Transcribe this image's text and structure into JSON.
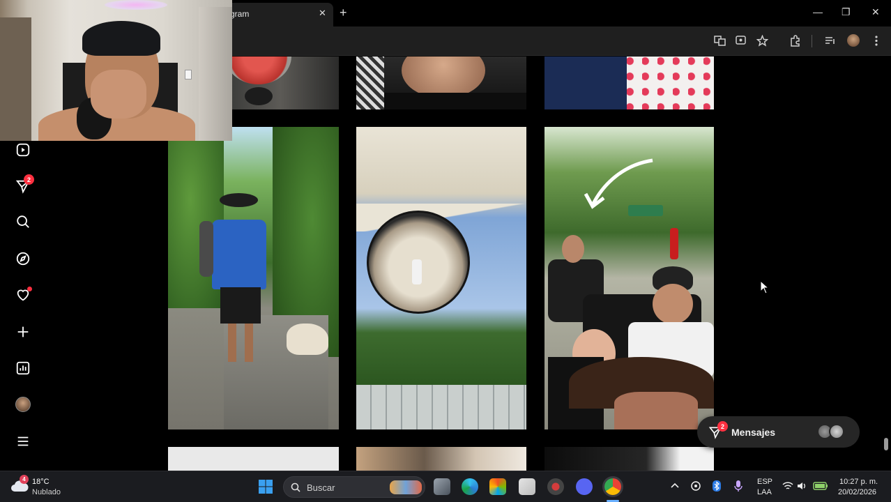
{
  "browser": {
    "tab_title": "gram",
    "tab_close": "✕",
    "new_tab": "+",
    "window_controls": {
      "minimize": "—",
      "maximize": "❐",
      "close": "✕"
    },
    "toolbar_icons": [
      "translate-icon",
      "cast-icon",
      "star-icon",
      "extensions-icon",
      "media-icon",
      "profile-avatar",
      "menu-icon"
    ]
  },
  "sidebar": {
    "items": [
      {
        "name": "reels",
        "icon": "reels-icon"
      },
      {
        "name": "messages",
        "icon": "send-icon",
        "badge": "2"
      },
      {
        "name": "search",
        "icon": "search-icon"
      },
      {
        "name": "explore",
        "icon": "compass-icon"
      },
      {
        "name": "notifications",
        "icon": "heart-icon",
        "dot": true
      },
      {
        "name": "create",
        "icon": "plus-icon"
      },
      {
        "name": "dashboard",
        "icon": "chart-icon"
      },
      {
        "name": "profile",
        "icon": "avatar-icon"
      },
      {
        "name": "more",
        "icon": "hamburger-icon"
      }
    ]
  },
  "messages_bar": {
    "label": "Mensajes",
    "badge": "2"
  },
  "taskbar": {
    "weather_temp": "18°C",
    "weather_condition": "Nublado",
    "weather_badge": "4",
    "search_placeholder": "Buscar",
    "language_top": "ESP",
    "language_bottom": "LAA",
    "time": "10:27 p. m.",
    "date": "20/02/2026"
  },
  "colors": {
    "accent_badge": "#ff3040",
    "background": "#000000",
    "pill": "#262626"
  }
}
